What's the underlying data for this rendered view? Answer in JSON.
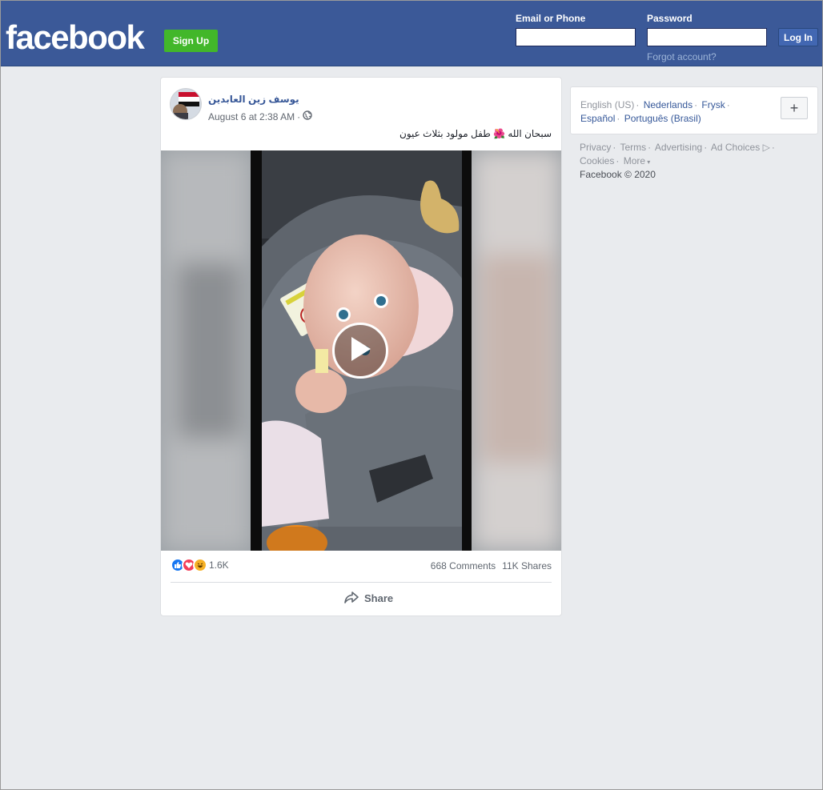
{
  "header": {
    "logo": "facebook",
    "signup_label": "Sign Up",
    "email_label": "Email or Phone",
    "email_value": "",
    "password_label": "Password",
    "password_value": "",
    "login_label": "Log In",
    "forgot_label": "Forgot account?"
  },
  "post": {
    "author": "يوسف زين العابدين",
    "timestamp": "August 6 at 2:38 AM",
    "privacy_icon": "globe-icon",
    "text": "سبحان الله 🌺 طفل مولود بثلاث عيون",
    "reactions_count": "1.6K",
    "reaction_icons": [
      "like-icon",
      "love-icon",
      "haha-icon"
    ],
    "comments": "668 Comments",
    "shares": "11K Shares",
    "share_label": "Share"
  },
  "sidebar": {
    "current_language": "English (US)",
    "languages": [
      "Nederlands",
      "Frysk",
      "Español",
      "Português (Brasil)"
    ],
    "add_language": "+",
    "footer_links": [
      "Privacy",
      "Terms",
      "Advertising",
      "Ad Choices",
      "Cookies",
      "More"
    ],
    "copyright": "Facebook © 2020"
  },
  "colors": {
    "brand_blue": "#3b5998",
    "signup_green": "#42b72a",
    "link_blue": "#365899",
    "page_bg": "#e9ebee"
  }
}
